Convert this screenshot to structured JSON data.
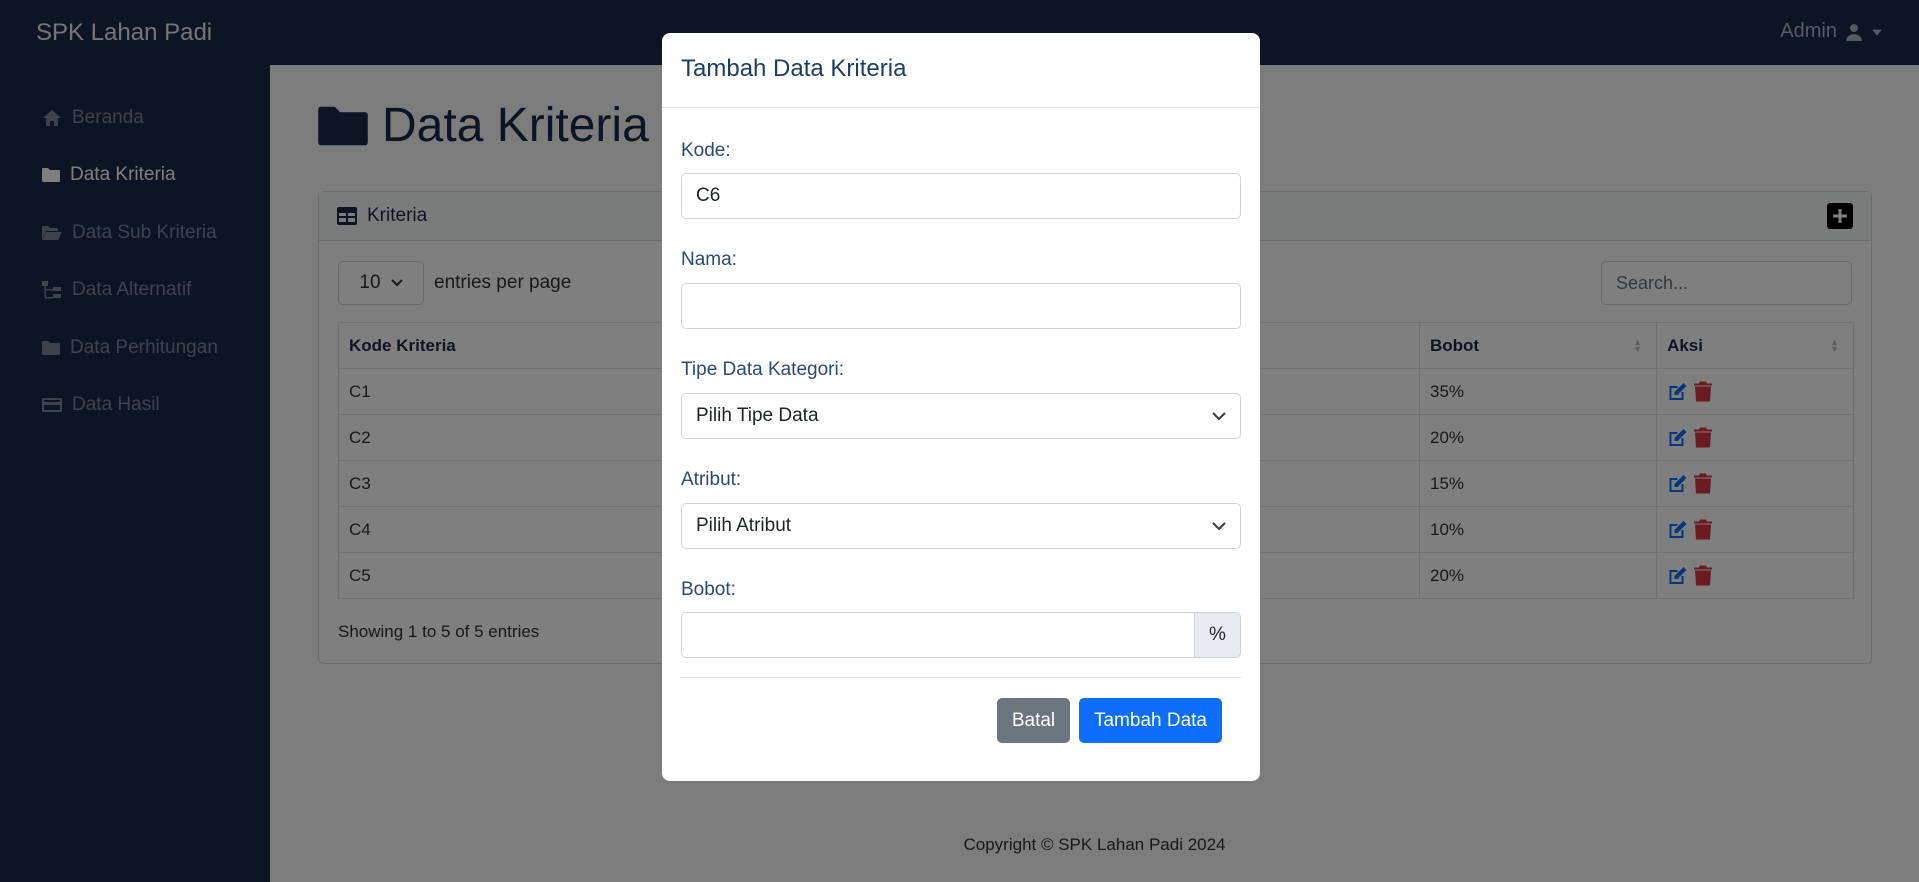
{
  "app": {
    "brand": "SPK Lahan Padi",
    "user": "Admin"
  },
  "sidebar": {
    "items": [
      {
        "label": "Beranda",
        "icon": "home-icon",
        "active": false
      },
      {
        "label": "Data Kriteria",
        "icon": "folder-icon",
        "active": true
      },
      {
        "label": "Data Sub Kriteria",
        "icon": "folder-open-icon",
        "active": false
      },
      {
        "label": "Data Alternatif",
        "icon": "sitemap-icon",
        "active": false
      },
      {
        "label": "Data Perhitungan",
        "icon": "folder-icon",
        "active": false
      },
      {
        "label": "Data Hasil",
        "icon": "credit-card-icon",
        "active": false
      }
    ]
  },
  "main": {
    "title": "Data Kriteria",
    "card_title": "Kriteria",
    "entries_value": "10",
    "entries_label": "entries per page",
    "search_placeholder": "Search...",
    "columns": [
      "Kode Kriteria",
      "Bobot",
      "Aksi"
    ],
    "rows": [
      {
        "kode": "C1",
        "bobot": "35%"
      },
      {
        "kode": "C2",
        "bobot": "20%"
      },
      {
        "kode": "C3",
        "bobot": "15%"
      },
      {
        "kode": "C4",
        "bobot": "10%"
      },
      {
        "kode": "C5",
        "bobot": "20%"
      }
    ],
    "showing": "Showing 1 to 5 of 5 entries",
    "footer": "Copyright © SPK Lahan Padi 2024"
  },
  "modal": {
    "title": "Tambah Data Kriteria",
    "kode_label": "Kode:",
    "kode_value": "C6",
    "nama_label": "Nama:",
    "nama_value": "",
    "tipe_label": "Tipe Data Kategori:",
    "tipe_value": "Pilih Tipe Data",
    "atribut_label": "Atribut:",
    "atribut_value": "Pilih Atribut",
    "bobot_label": "Bobot:",
    "bobot_value": "",
    "bobot_suffix": "%",
    "cancel_label": "Batal",
    "submit_label": "Tambah Data"
  },
  "colors": {
    "navy": "#1c2b44",
    "primary": "#0d6efd",
    "secondary": "#6c757d",
    "danger": "#dc3545"
  }
}
